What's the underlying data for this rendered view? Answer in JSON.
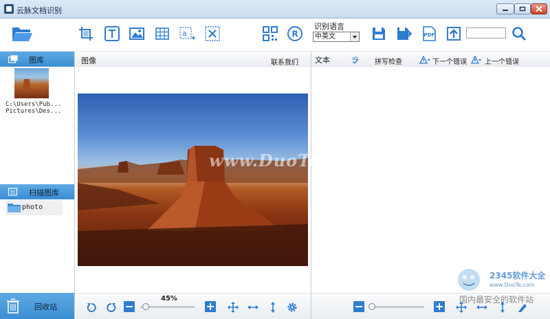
{
  "window": {
    "title": "云脉文档识别"
  },
  "toolbar": {
    "buttons": [
      {
        "name": "open-folder",
        "icon": "folder-open-icon"
      },
      {
        "name": "crop",
        "icon": "crop-icon"
      },
      {
        "name": "text-region",
        "icon": "text-region-icon"
      },
      {
        "name": "image-region",
        "icon": "image-region-icon"
      },
      {
        "name": "table-region",
        "icon": "table-region-icon"
      },
      {
        "name": "add-text",
        "icon": "add-text-icon"
      },
      {
        "name": "delete-region",
        "icon": "delete-region-icon"
      },
      {
        "name": "qrcode",
        "icon": "qrcode-icon"
      },
      {
        "name": "recognize",
        "icon": "recognize-icon"
      },
      {
        "name": "save",
        "icon": "save-icon"
      },
      {
        "name": "save-as",
        "icon": "save-as-icon"
      },
      {
        "name": "export-pdf",
        "icon": "pdf-icon"
      },
      {
        "name": "upload",
        "icon": "upload-icon"
      },
      {
        "name": "search",
        "icon": "search-icon"
      }
    ],
    "lang_label": "识别语言",
    "lang_value": "中英文",
    "search_value": ""
  },
  "sidebar": {
    "gallery_label": "图库",
    "thumb_path_line1": "C:\\Users\\Pub...",
    "thumb_path_line2": "Pictures\\Des...",
    "scan_label": "扫描图库",
    "folder_label": "photo",
    "recycle_label": "回收站"
  },
  "image_panel": {
    "title": "图像",
    "contact": "联系我们",
    "zoom": "45%",
    "zoom_fraction": 0.1
  },
  "text_panel": {
    "title": "文本",
    "spell_check": "拼写检查",
    "next_error": "下一个错误",
    "prev_error": "上一个错误",
    "zoom_fraction": 0.05
  },
  "watermarks": {
    "duote": "www.DuoTe.com",
    "brand": "2345软件大全",
    "url": "www.DuoTe.com",
    "cn": "国内最安全的软件站"
  },
  "colors": {
    "accent": "#2e7cd0",
    "sidebar_header": "#4a9ada"
  }
}
